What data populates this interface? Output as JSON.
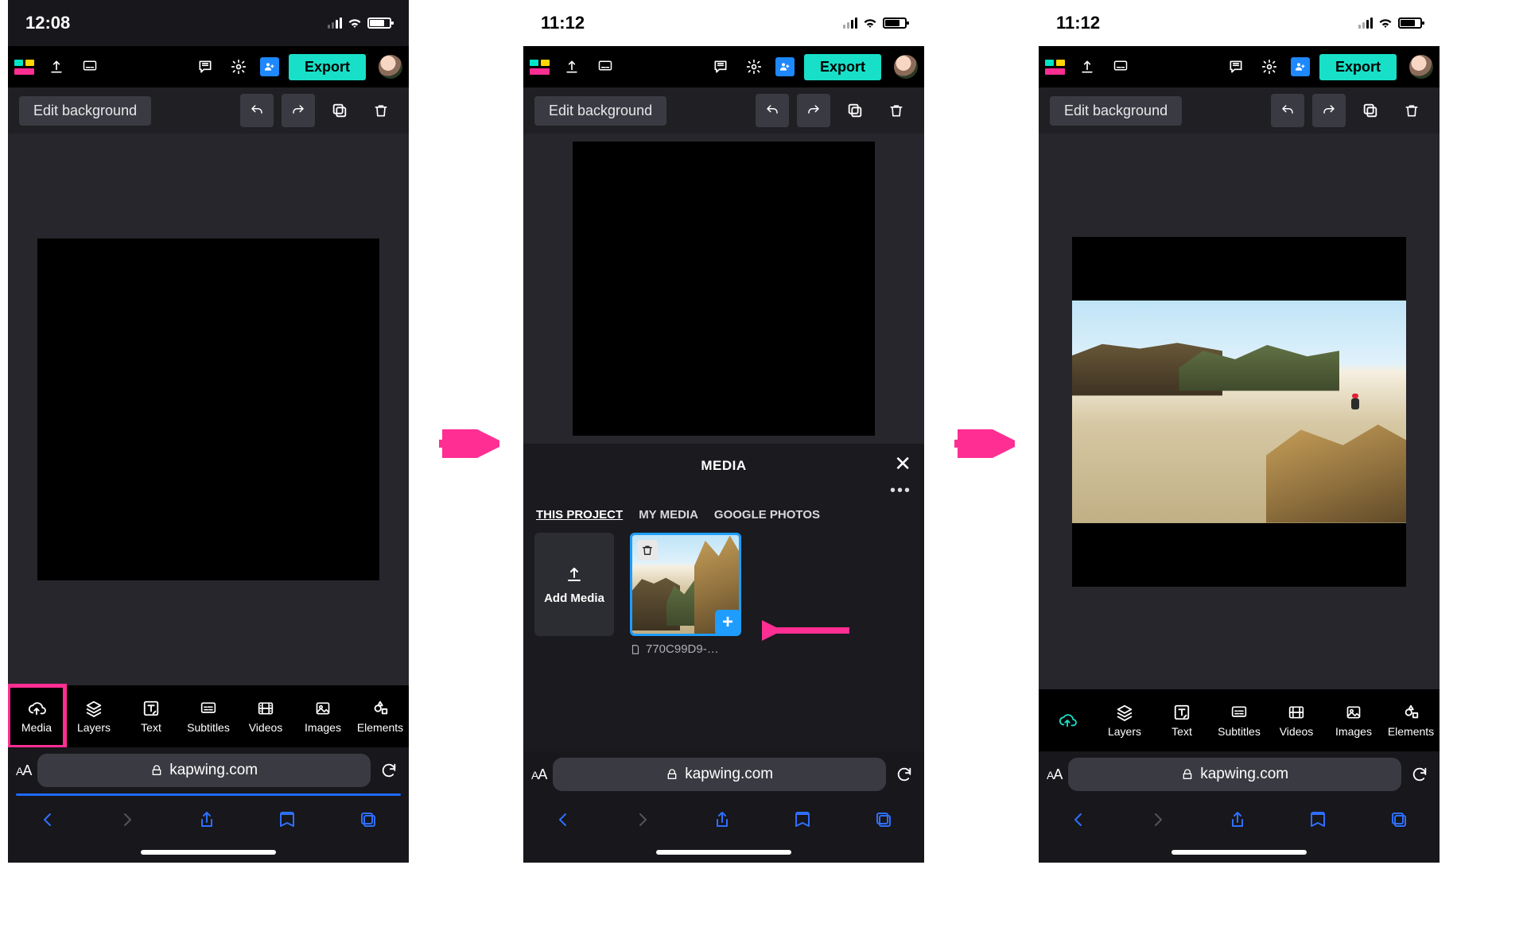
{
  "screens": [
    {
      "time": "12:08",
      "status_style": "dark"
    },
    {
      "time": "11:12",
      "status_style": "light"
    },
    {
      "time": "11:12",
      "status_style": "light"
    }
  ],
  "app_bar": {
    "export_label": "Export"
  },
  "secondary_bar": {
    "edit_background_label": "Edit background"
  },
  "tool_row": {
    "media": "Media",
    "layers": "Layers",
    "text": "Text",
    "subtitles": "Subtitles",
    "videos": "Videos",
    "images": "Images",
    "elements": "Elements"
  },
  "media_panel": {
    "title": "MEDIA",
    "tabs": [
      "THIS PROJECT",
      "MY MEDIA",
      "GOOGLE PHOTOS"
    ],
    "active_tab_index": 0,
    "add_media_label": "Add Media",
    "thumbnail_filename": "770C99D9-…"
  },
  "browser": {
    "url_display": "kapwing.com"
  }
}
